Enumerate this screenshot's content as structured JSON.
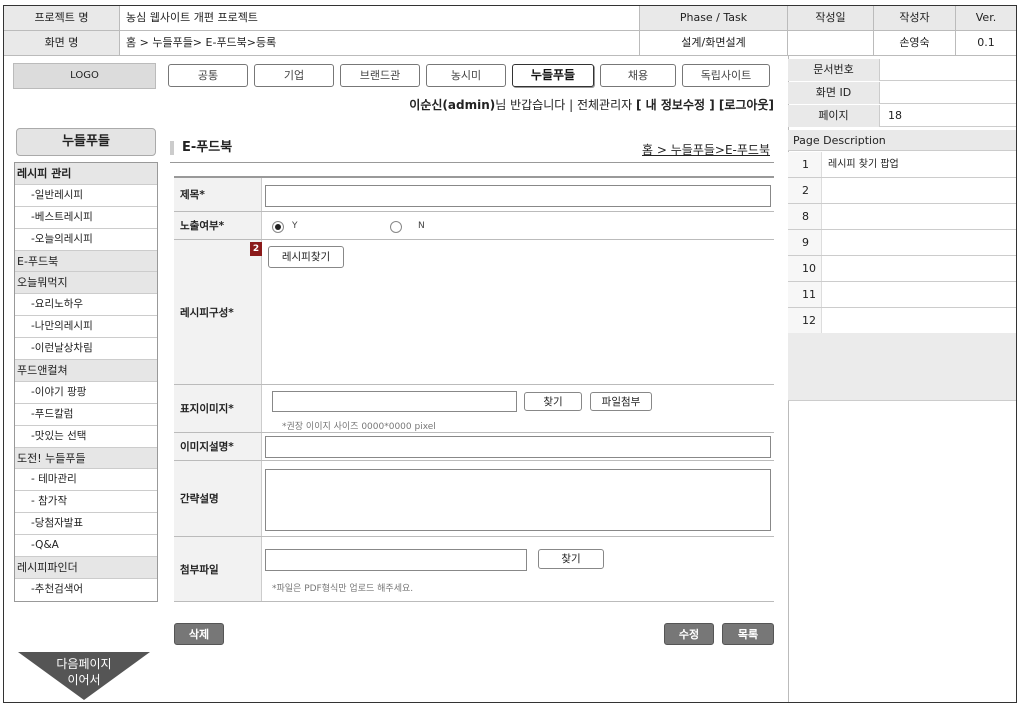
{
  "header": {
    "project_label": "프로젝트 명",
    "project_value": "농심 웹사이트 개편 프로젝트",
    "phase_label": "Phase / Task",
    "created_label": "작성일",
    "author_label": "작성자",
    "ver_label": "Ver.",
    "screen_label": "화면 명",
    "screen_value": "홈 > 누들푸들> E-푸드북>등록",
    "phase_value": "설계/화면설계",
    "created_value": "",
    "author_value": "손영숙",
    "ver_value": "0.1"
  },
  "meta": {
    "doc_no_label": "문서번호",
    "doc_no_value": "",
    "screen_id_label": "화면 ID",
    "screen_id_value": "",
    "page_label": "페이지",
    "page_value": "18",
    "page_desc_label": "Page Description",
    "descriptions": [
      {
        "n": "1",
        "text": "레시피 찾기 팝업"
      },
      {
        "n": "2",
        "text": ""
      },
      {
        "n": "8",
        "text": ""
      },
      {
        "n": "9",
        "text": ""
      },
      {
        "n": "10",
        "text": ""
      },
      {
        "n": "11",
        "text": ""
      },
      {
        "n": "12",
        "text": ""
      }
    ]
  },
  "nav": {
    "logo": "LOGO",
    "tabs": [
      "공통",
      "기업",
      "브랜드관",
      "농시미",
      "누들푸들",
      "채용",
      "독립사이트"
    ],
    "active_tab": "누들푸들",
    "user_name": "이순신(admin)",
    "user_greeting": "님 반갑습니다 | 전체관리자",
    "user_links": "[ 내 정보수정 ] [로그아웃]"
  },
  "sidebar": {
    "title": "누들푸들",
    "items": [
      {
        "label": "레시피 관리",
        "type": "cat"
      },
      {
        "label": "-일반레시피",
        "type": "sub"
      },
      {
        "label": "-베스트레시피",
        "type": "sub"
      },
      {
        "label": "-오늘의레시피",
        "type": "sub"
      },
      {
        "label": "E-푸드북",
        "type": "cat"
      },
      {
        "label": "오늘뭐먹지",
        "type": "cat"
      },
      {
        "label": "-요리노하우",
        "type": "sub"
      },
      {
        "label": "-나만의레시피",
        "type": "sub"
      },
      {
        "label": "-이런날상차림",
        "type": "sub"
      },
      {
        "label": "푸드앤컬쳐",
        "type": "cat"
      },
      {
        "label": "-이야기 팡팡",
        "type": "sub"
      },
      {
        "label": "-푸드칼럼",
        "type": "sub"
      },
      {
        "label": "-맛있는 선택",
        "type": "sub"
      },
      {
        "label": "도전! 누들푸들",
        "type": "cat"
      },
      {
        "label": "- 테마관리",
        "type": "sub"
      },
      {
        "label": "- 참가작",
        "type": "sub"
      },
      {
        "label": "-당첨자발표",
        "type": "sub"
      },
      {
        "label": "-Q&A",
        "type": "sub"
      },
      {
        "label": "레시피파인더",
        "type": "cat"
      },
      {
        "label": "-추천검색어",
        "type": "sub"
      }
    ],
    "next_page_line1": "다음페이지",
    "next_page_line2": "이어서"
  },
  "main": {
    "title": "E-푸드북",
    "breadcrumb": "홈 > 누들푸들>E-푸드북",
    "form": {
      "title_label": "제목*",
      "title_value": "",
      "expose_label": "노출여부*",
      "expose_y": "Y",
      "expose_n": "N",
      "expose_selected": "Y",
      "recipe_label": "레시피구성*",
      "recipe_badge": "2",
      "recipe_find_button": "레시피찾기",
      "cover_label": "표지이미지*",
      "cover_find_button": "찾기",
      "cover_attach_button": "파일첨부",
      "cover_hint": "*권장 이이지 사이즈 0000*0000 pixel",
      "image_desc_label": "이미지설명*",
      "summary_label": "간략설명",
      "attach_label": "첨부파일",
      "attach_find_button": "찾기",
      "attach_hint": "*파일은 PDF형식만 업로드 해주세요."
    },
    "delete_button": "삭제",
    "edit_button": "수정",
    "list_button": "목록"
  }
}
